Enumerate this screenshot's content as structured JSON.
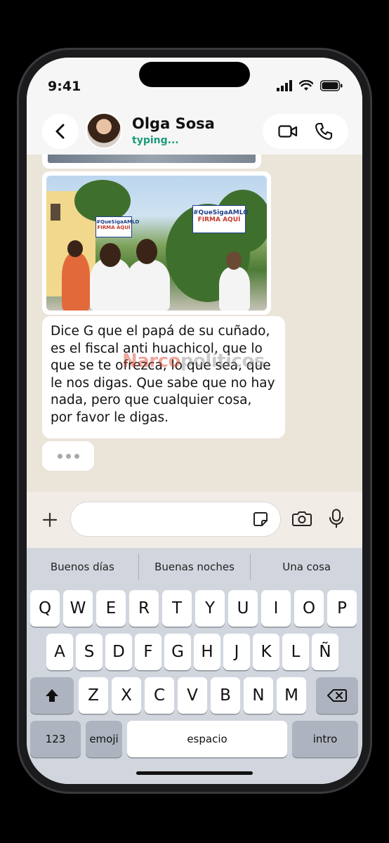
{
  "status_bar": {
    "time": "9:41"
  },
  "header": {
    "contact_name": "Olga Sosa",
    "contact_status": "typing..."
  },
  "chat": {
    "photo_sign_1": "#QueSigaAMLO",
    "photo_sign_1_sub": "FIRMA AQUÍ",
    "photo_sign_2": "#QueSigaAMLO",
    "photo_sign_2_sub": "FIRMA AQUÍ",
    "message_text": "Dice G que el papá de su cuñado, es el fiscal anti huachicol, que lo que se te ofrezca, lo que sea, que le nos digas. Que sabe que no hay nada, pero que cualquier cosa, por favor le digas.",
    "watermark_a": "Narco",
    "watermark_b": "políticos"
  },
  "composer": {
    "input_value": "",
    "input_placeholder": ""
  },
  "keyboard": {
    "suggestions": [
      "Buenos días",
      "Buenas noches",
      "Una cosa"
    ],
    "row1": [
      "Q",
      "W",
      "E",
      "R",
      "T",
      "Y",
      "U",
      "I",
      "O",
      "P"
    ],
    "row2": [
      "A",
      "S",
      "D",
      "F",
      "G",
      "H",
      "J",
      "K",
      "L",
      "Ñ"
    ],
    "row3": [
      "Z",
      "X",
      "C",
      "V",
      "B",
      "N",
      "M"
    ],
    "key_123": "123",
    "key_emoji": "emoji",
    "key_space": "espacio",
    "key_return": "intro"
  },
  "colors": {
    "accent_green": "#1c9a7a",
    "chat_bg": "#ebe4d9",
    "keyboard_bg": "#d1d6de"
  },
  "icons": [
    "back-icon",
    "video-call-icon",
    "phone-icon",
    "plus-icon",
    "sticker-icon",
    "camera-icon",
    "mic-icon",
    "shift-icon",
    "backspace-icon",
    "signal-icon",
    "wifi-icon",
    "battery-icon"
  ]
}
